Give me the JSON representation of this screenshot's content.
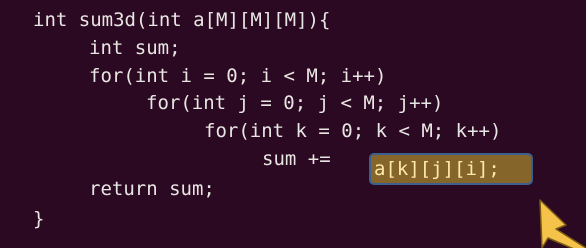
{
  "code": {
    "lines": [
      "int sum3d(int a[M][M][M]){",
      "int sum;",
      "for(int i = 0; i < M; i++)",
      "for(int j = 0; j < M; j++)",
      "for(int k = 0; k < M; k++)",
      "sum += ",
      "return sum;",
      "}"
    ],
    "highlighted_expression": "a[k][j][i];"
  },
  "colors": {
    "background": "#2c0922",
    "text": "#e8e6e3",
    "highlight_fill": "#85652a",
    "highlight_border": "#3b5f8f",
    "arrow": "#f6c34a"
  },
  "icons": {
    "pointer": "arrow-icon"
  }
}
